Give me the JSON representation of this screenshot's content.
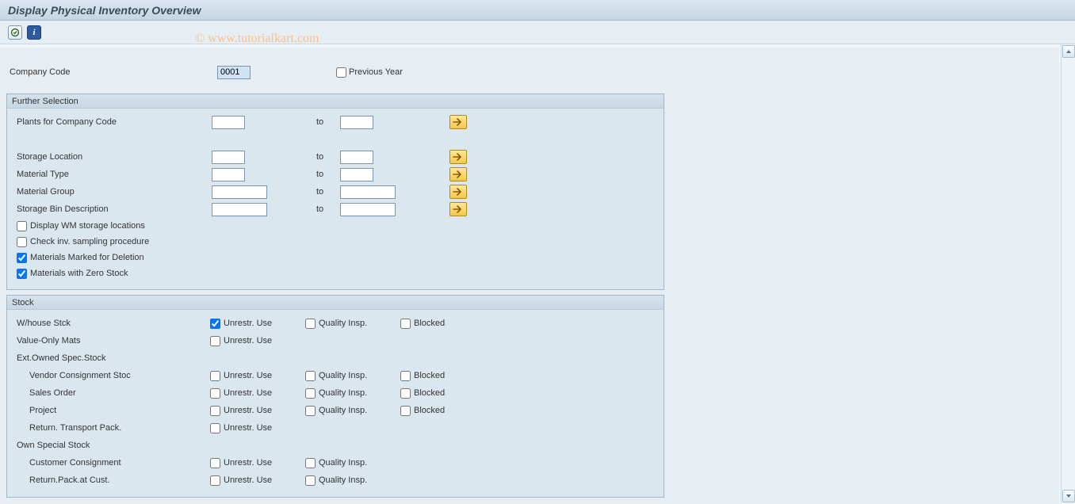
{
  "title": "Display Physical Inventory Overview",
  "watermark": "© www.tutorialkart.com",
  "header": {
    "company_code_label": "Company Code",
    "company_code_value": "0001",
    "previous_year_label": "Previous Year",
    "previous_year_checked": false
  },
  "further_selection": {
    "title": "Further Selection",
    "to_label": "to",
    "rows": [
      {
        "label": "Plants for Company Code",
        "from": "",
        "to": "",
        "input_class": "inp-short"
      },
      {
        "label": "Storage Location",
        "from": "",
        "to": "",
        "input_class": "inp-short"
      },
      {
        "label": "Material Type",
        "from": "",
        "to": "",
        "input_class": "inp-short"
      },
      {
        "label": "Material Group",
        "from": "",
        "to": "",
        "input_class": "inp-med"
      },
      {
        "label": "Storage Bin Description",
        "from": "",
        "to": "",
        "input_class": "inp-med"
      }
    ],
    "checkboxes": [
      {
        "label": "Display WM storage locations",
        "checked": false
      },
      {
        "label": "Check inv. sampling procedure",
        "checked": false
      },
      {
        "label": "Materials Marked for Deletion",
        "checked": true
      },
      {
        "label": "Materials with Zero Stock",
        "checked": true
      }
    ]
  },
  "stock": {
    "title": "Stock",
    "col_labels": {
      "unrestr": "Unrestr. Use",
      "quality": "Quality Insp.",
      "blocked": "Blocked"
    },
    "rows": [
      {
        "label": "W/house Stck",
        "indent": false,
        "unrestr": true,
        "quality": false,
        "blocked": false,
        "has_quality": true,
        "has_blocked": true
      },
      {
        "label": "Value-Only Mats",
        "indent": false,
        "unrestr": false,
        "has_quality": false,
        "has_blocked": false
      },
      {
        "label": "Ext.Owned Spec.Stock",
        "indent": false,
        "heading": true
      },
      {
        "label": "Vendor Consignment Stoc",
        "indent": true,
        "unrestr": false,
        "quality": false,
        "blocked": false,
        "has_quality": true,
        "has_blocked": true
      },
      {
        "label": "Sales Order",
        "indent": true,
        "unrestr": false,
        "quality": false,
        "blocked": false,
        "has_quality": true,
        "has_blocked": true
      },
      {
        "label": "Project",
        "indent": true,
        "unrestr": false,
        "quality": false,
        "blocked": false,
        "has_quality": true,
        "has_blocked": true
      },
      {
        "label": "Return. Transport Pack.",
        "indent": true,
        "unrestr": false,
        "has_quality": false,
        "has_blocked": false
      },
      {
        "label": "Own Special Stock",
        "indent": false,
        "heading": true
      },
      {
        "label": "Customer Consignment",
        "indent": true,
        "unrestr": false,
        "quality": false,
        "has_quality": true,
        "has_blocked": false
      },
      {
        "label": "Return.Pack.at Cust.",
        "indent": true,
        "unrestr": false,
        "quality": false,
        "has_quality": true,
        "has_blocked": false
      }
    ]
  }
}
